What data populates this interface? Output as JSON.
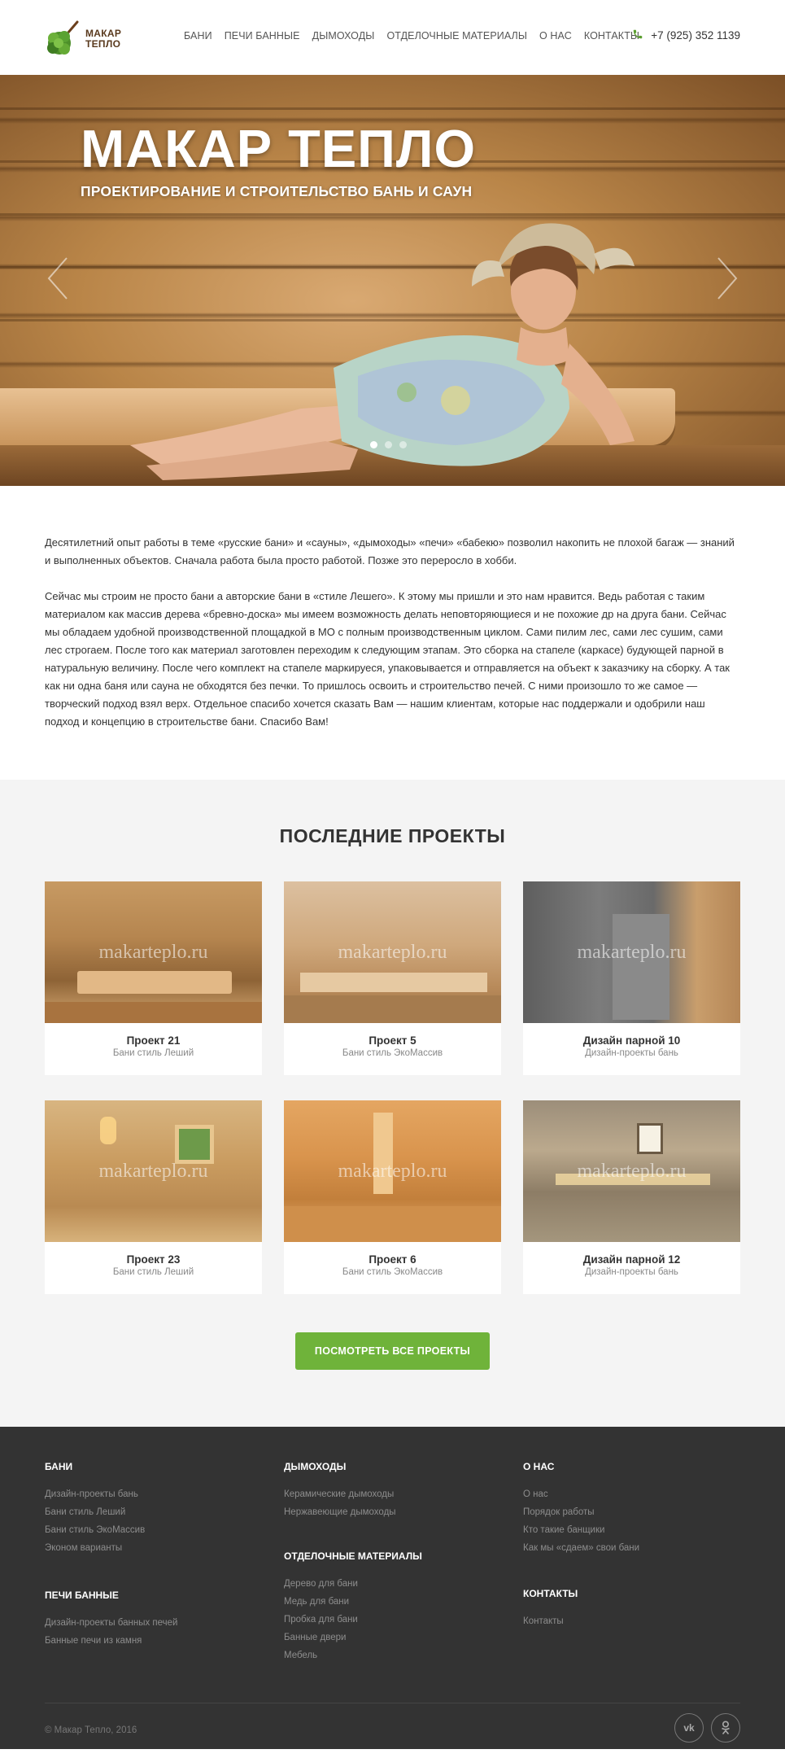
{
  "header": {
    "logo_line1": "МАКАР",
    "logo_line2": "ТЕПЛО",
    "nav": [
      "БАНИ",
      "ПЕЧИ БАННЫЕ",
      "ДЫМОХОДЫ",
      "ОТДЕЛОЧНЫЕ МАТЕРИАЛЫ",
      "О НАС",
      "КОНТАКТЫ"
    ],
    "phone": "+7 (925) 352 1139",
    "phone_icon": "phone-icon"
  },
  "hero": {
    "title": "МАКАР ТЕПЛО",
    "subtitle": "ПРОЕКТИРОВАНИЕ И СТРОИТЕЛЬСТВО БАНЬ И САУН",
    "slides_count": 3,
    "active_slide": 1
  },
  "about": {
    "p1": "Десятилетний опыт работы в теме «русские бани» и «сауны», «дымоходы» «печи» «бабекю» позволил накопить не плохой багаж — знаний и выполненных объектов. Сначала работа была просто работой. Позже это переросло в хобби.",
    "p2": "Сейчас мы строим не просто бани а авторские бани в «стиле Лешего». К этому мы пришли и это нам нравится. Ведь работая с таким материалом как массив дерева «бревно-доска» мы имеем возможность делать неповторяющиеся и не похожие др на друга бани. Сейчас мы обладаем удобной производственной площадкой в МО с полным производственным циклом. Сами пилим лес, сами лес сушим, сами лес строгаем. После того как материал заготовлен переходим к следующим этапам. Это сборка на стапеле (каркасе) будующей парной в натуральную величину. После чего комплект на стапеле маркируеся, упаковывается и отправляется на объект к заказчику на сборку. А так как ни одна баня или сауна не обходятся без печки. То пришлось освоить и строительство печей. С ними произошло то же самое — творческий подход взял верх. Отдельное спасибо хочется сказать Вам — нашим клиентам, которые нас поддержали и одобрили наш подход и концепцию в строительстве бани. Спасибо Вам!"
  },
  "projects": {
    "heading": "ПОСЛЕДНИЕ ПРОЕКТЫ",
    "watermark": "makarteplo.ru",
    "items": [
      {
        "title": "Проект 21",
        "subtitle": "Бани стиль Леший"
      },
      {
        "title": "Проект 5",
        "subtitle": "Бани стиль ЭкоМассив"
      },
      {
        "title": "Дизайн парной 10",
        "subtitle": "Дизайн-проекты бань"
      },
      {
        "title": "Проект 23",
        "subtitle": "Бани стиль Леший"
      },
      {
        "title": "Проект 6",
        "subtitle": "Бани стиль ЭкоМассив"
      },
      {
        "title": "Дизайн парной 12",
        "subtitle": "Дизайн-проекты бань"
      }
    ],
    "button": "ПОСМОТРЕТЬ ВСЕ ПРОЕКТЫ"
  },
  "footer": {
    "bani": {
      "title": "БАНИ",
      "links": [
        "Дизайн-проекты бань",
        "Бани стиль Леший",
        "Бани стиль ЭкоМассив",
        "Эконом варианты"
      ]
    },
    "pechi": {
      "title": "ПЕЧИ БАННЫЕ",
      "links": [
        "Дизайн-проекты банных печей",
        "Банные печи из камня"
      ]
    },
    "dym": {
      "title": "ДЫМОХОДЫ",
      "links": [
        "Керамические дымоходы",
        "Нержавеющие дымоходы"
      ]
    },
    "otd": {
      "title": "ОТДЕЛОЧНЫЕ МАТЕРИАЛЫ",
      "links": [
        "Дерево для бани",
        "Медь для бани",
        "Пробка для бани",
        "Банные двери",
        "Мебель"
      ]
    },
    "onas": {
      "title": "О НАС",
      "links": [
        "О нас",
        "Порядок работы",
        "Кто такие банщики",
        "Как мы «сдаем» свои бани"
      ]
    },
    "kontakty": {
      "title": "КОНТАКТЫ",
      "links": [
        "Контакты"
      ]
    },
    "copyright": "© Макар Тепло, 2016",
    "social": [
      "vk-icon",
      "odnoklassniki-icon"
    ]
  },
  "colors": {
    "accent": "#6fb33a",
    "footer_bg": "#333333",
    "section_bg": "#f4f4f4"
  }
}
